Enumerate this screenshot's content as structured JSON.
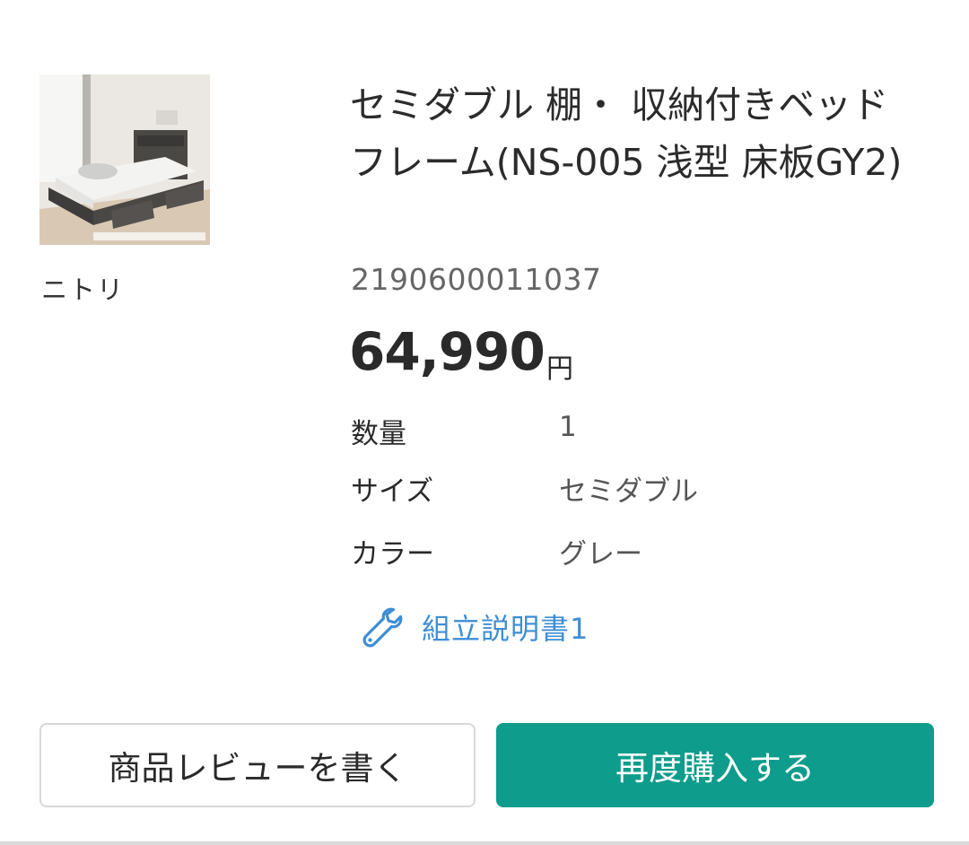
{
  "product": {
    "image_alt": "セミダブル 棚・収納付きベッドフレーム",
    "brand": "ニトリ",
    "title": "セミダブル 棚・ 収納付きベッドフレーム(NS-005 浅型 床板GY2)",
    "jan_code": "2190600011037",
    "price": "64,990",
    "price_unit": "円"
  },
  "specs": [
    {
      "label": "数量",
      "value": "1"
    },
    {
      "label": "サイズ",
      "value": "セミダブル"
    },
    {
      "label": "カラー",
      "value": "グレー"
    }
  ],
  "manual": {
    "icon": "wrench-icon",
    "label": "組立説明書1"
  },
  "buttons": {
    "review_label": "商品レビューを書く",
    "rebuy_label": "再度購入する"
  },
  "colors": {
    "accent": "#0e9c8c",
    "link": "#3d8ed4"
  }
}
